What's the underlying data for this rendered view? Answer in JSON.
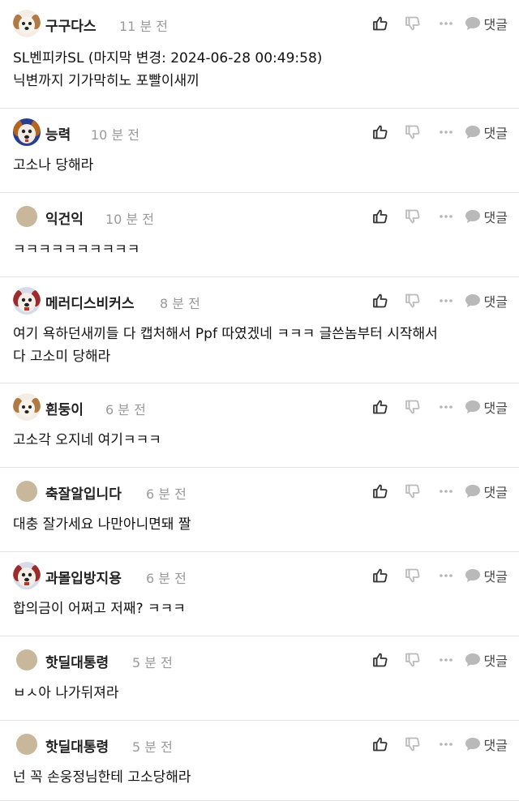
{
  "reply_label": "댓글",
  "comments": [
    {
      "nickname": "구구다스",
      "time": "11 분 전",
      "avatar": "puppy-avatar",
      "body": "SL벤피카SL (마지막 변경: 2024-06-28 00:49:58)\n닉변까지 기가막히노 포빨이새끼"
    },
    {
      "nickname": "능력",
      "time": "10 분 전",
      "avatar": "dog-face-avatar-blue",
      "body": "고소나 당해라"
    },
    {
      "nickname": "익건익",
      "time": "10 분 전",
      "avatar": "default-avatar",
      "body": "ㅋㅋㅋㅋㅋㅋㅋㅋㅋㅋ"
    },
    {
      "nickname": "메러디스비커스",
      "time": "8 분 전",
      "avatar": "dog-face-avatar-red",
      "body": "여기 욕하던새끼들 다 캡처해서 Ppf 따였겠네 ㅋㅋㅋ 글쓴놈부터 시작해서\n다 고소미 당해라"
    },
    {
      "nickname": "흰둥이",
      "time": "6 분 전",
      "avatar": "puppy-avatar",
      "body": "고소각 오지네 여기ㅋㅋㅋ"
    },
    {
      "nickname": "축잘알입니다",
      "time": "6 분 전",
      "avatar": "default-avatar",
      "body": "대충 잘가세요 나만아니면돼 짤"
    },
    {
      "nickname": "과몰입방지용",
      "time": "6 분 전",
      "avatar": "dog-face-avatar-red",
      "body": "합의금이 어쩌고 저째? ㅋㅋㅋ"
    },
    {
      "nickname": "핫딜대통령",
      "time": "5 분 전",
      "avatar": "default-avatar",
      "body": "ㅂㅅ아 나가뒤져라"
    },
    {
      "nickname": "핫딜대통령",
      "time": "5 분 전",
      "avatar": "default-avatar",
      "body": "넌 꼭 손웅정님한테 고소당해라"
    }
  ]
}
